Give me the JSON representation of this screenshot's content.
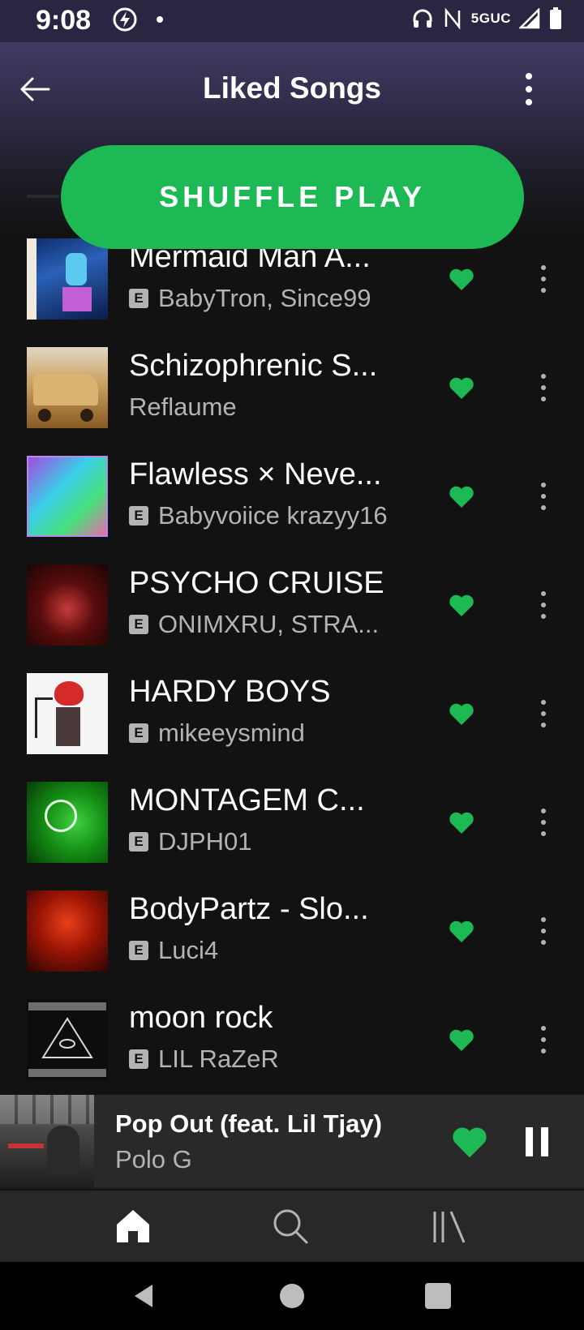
{
  "status_bar": {
    "time": "9:08",
    "network": "5GUC"
  },
  "header": {
    "title": "Liked Songs"
  },
  "shuffle_button": {
    "label": "SHUFFLE PLAY",
    "color": "#1db954"
  },
  "songs": [
    {
      "title": "Mermaid Man A...",
      "artist": "BabyTron, Since99",
      "explicit": true,
      "liked": true
    },
    {
      "title": "Schizophrenic S...",
      "artist": "Reflaume",
      "explicit": false,
      "liked": true
    },
    {
      "title": "Flawless × Neve...",
      "artist": "Babyvoiice krazyy16",
      "explicit": true,
      "liked": true
    },
    {
      "title": "PSYCHO CRUISE",
      "artist": "ONIMXRU, STRA...",
      "explicit": true,
      "liked": true
    },
    {
      "title": "HARDY BOYS",
      "artist": "mikeeysmind",
      "explicit": true,
      "liked": true
    },
    {
      "title": "MONTAGEM C...",
      "artist": "DJPH01",
      "explicit": true,
      "liked": true
    },
    {
      "title": "BodyPartz - Slo...",
      "artist": "Luci4",
      "explicit": true,
      "liked": true
    },
    {
      "title": "moon rock",
      "artist": "LIL RaZeR",
      "explicit": true,
      "liked": true
    }
  ],
  "explicit_badge": "E",
  "mini_player": {
    "title": "Pop Out (feat. Lil Tjay)",
    "artist": "Polo G",
    "liked": true,
    "state": "playing"
  },
  "bottom_nav": {
    "items": [
      "home-icon",
      "search-icon",
      "library-icon"
    ],
    "active": "home-icon"
  },
  "accent_color": "#1db954"
}
